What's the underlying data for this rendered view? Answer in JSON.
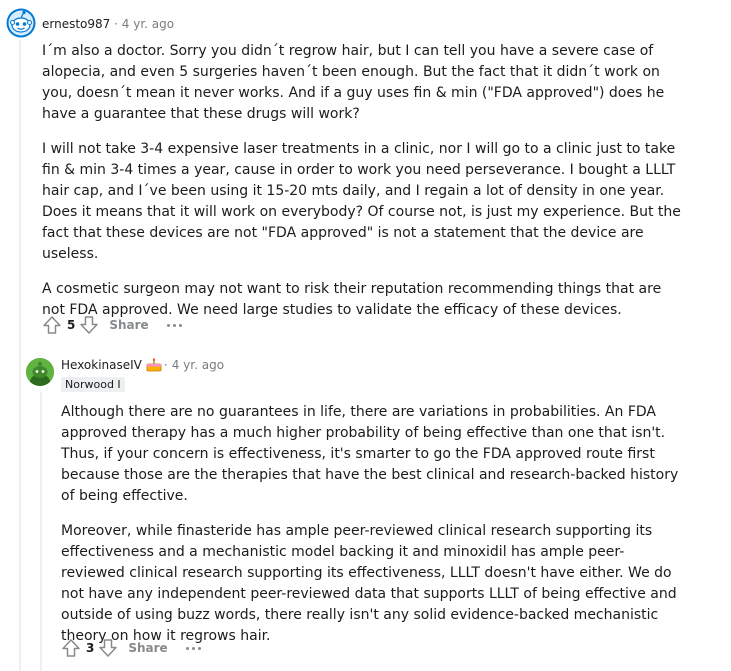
{
  "comments": [
    {
      "author": "ernesto987",
      "separator": "·",
      "time": "4 yr. ago",
      "paragraphs": [
        "I´m also a doctor. Sorry you didn´t regrow hair, but I can tell you have a severe case of alopecia, and even 5 surgeries haven´t been enough. But the fact that it didn´t work on you, doesn´t mean it never works. And if a guy uses fin & min (\"FDA approved\") does he have a guarantee that these drugs will work?",
        "I will not take 3-4 expensive laser treatments in a clinic, nor I will go to a clinic just to take fin & min 3-4 times a year, cause in order to work you need perseverance. I bought a LLLT hair cap, and I´ve been using it 15-20 mts daily, and I regain a lot of density in one year. Does it means that it will work on everybody? Of course not, is just my experience. But the fact that these devices are not \"FDA approved\" is not a statement that the device are useless.",
        "A cosmetic surgeon may not want to risk their reputation recommending things that are not FDA approved. We need large studies to validate the efficacy of these devices."
      ],
      "score": "5",
      "share_label": "Share",
      "avatar_icon": "snoo-avatar-icon",
      "accent_color": "#0079d3"
    },
    {
      "author": "HexokinaseIV",
      "separator": "·",
      "time": "4 yr. ago",
      "flair": "Norwood I",
      "paragraphs": [
        "Although there are no guarantees in life, there are variations in probabilities. An FDA approved therapy has a much higher probability of being effective than one that isn't. Thus, if your concern is effectiveness, it's smarter to go the FDA approved route first because those are the therapies that have the best clinical and research-backed history of being effective.",
        "Moreover, while finasteride has ample peer-reviewed clinical research supporting its effectiveness and a mechanistic model backing it and minoxidil has ample peer-reviewed clinical research supporting its effectiveness, LLLT doesn't have either. We do not have any independent peer-reviewed data that supports LLLT of being effective and outside of using buzz words, there really isn't any solid evidence-backed mechanistic theory on how it regrows hair."
      ],
      "score": "3",
      "share_label": "Share",
      "avatar_icon": "snoo-avatar-icon",
      "badge_icon": "cake-day-icon",
      "accent_color": "#5fb340"
    }
  ]
}
